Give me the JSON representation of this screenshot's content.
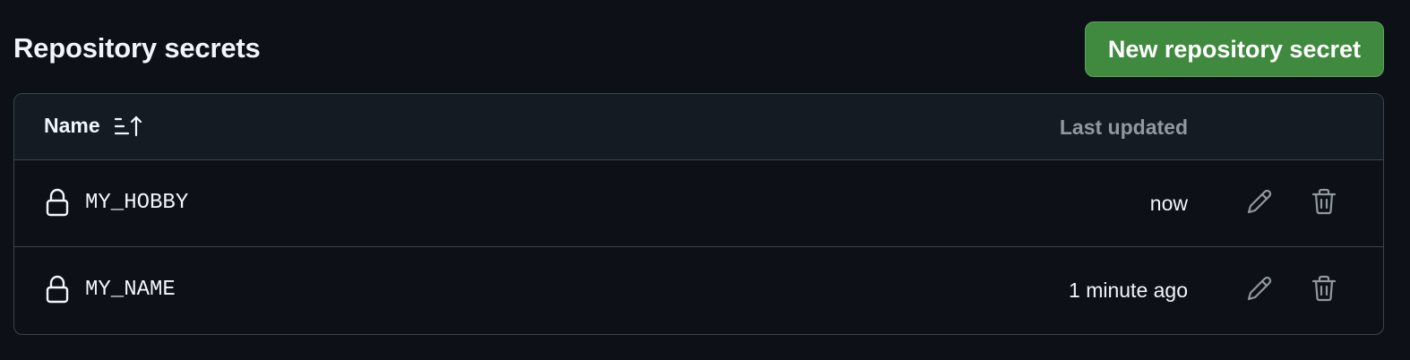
{
  "header": {
    "title": "Repository secrets",
    "new_button_label": "New repository secret"
  },
  "table": {
    "columns": {
      "name": "Name",
      "last_updated": "Last updated"
    },
    "rows": [
      {
        "name": "MY_HOBBY",
        "updated": "now"
      },
      {
        "name": "MY_NAME",
        "updated": "1 minute ago"
      }
    ]
  },
  "icons": {
    "sort": "sort-ascending-icon",
    "lock": "lock-icon",
    "edit": "pencil-icon",
    "delete": "trash-icon"
  },
  "colors": {
    "background": "#0d1117",
    "header_background": "#151b23",
    "border": "#3d444d",
    "primary_button": "#3f8a3f",
    "muted_text": "#9198a1"
  }
}
